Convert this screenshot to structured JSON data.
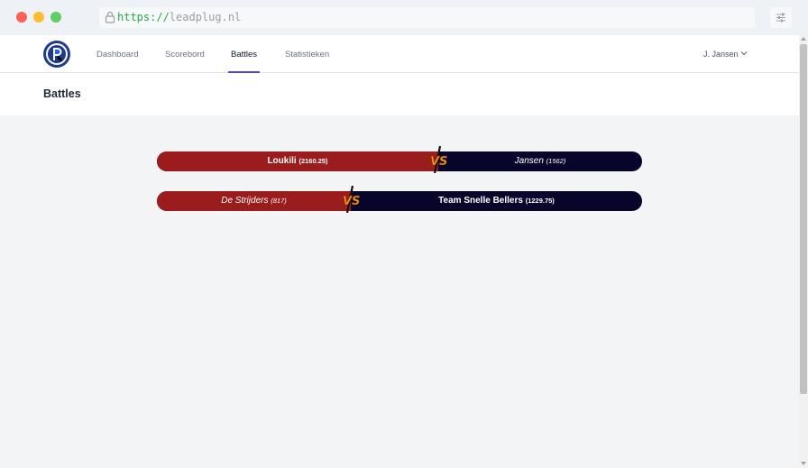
{
  "browser": {
    "url_scheme": "https://",
    "url_host": "leadplug.nl"
  },
  "nav": {
    "links": [
      "Dashboard",
      "Scorebord",
      "Battles",
      "Statistieken"
    ],
    "active": "Battles",
    "user": "J. Jansen"
  },
  "page": {
    "title": "Battles"
  },
  "battles": [
    {
      "left_name": "Loukili",
      "left_score": "(2160.25)",
      "right_name": "Jansen",
      "right_score": "(1562)",
      "left_share": 0.58,
      "left_leading": true
    },
    {
      "left_name": "De Strijders",
      "left_score": "(817)",
      "right_name": "Team Snelle Bellers",
      "right_score": "(1229.75)",
      "left_share": 0.4,
      "left_leading": false
    }
  ],
  "colors": {
    "left_team": "#9b1c1c",
    "right_team": "#08052b",
    "active_nav": "#4f46e5",
    "vs_badge": "#f59e0b"
  }
}
